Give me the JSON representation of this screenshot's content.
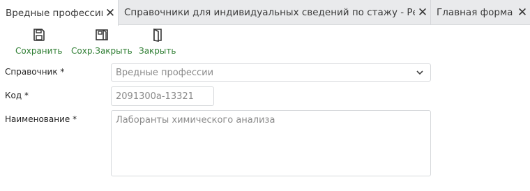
{
  "tabs": [
    {
      "label": "Вредные профессии",
      "active": true
    },
    {
      "label": "Справочники для индивидуальных сведений по стажу - Реестр",
      "active": false
    },
    {
      "label": "Главная форма",
      "active": false
    }
  ],
  "toolbar": {
    "save_label": "Сохранить",
    "save_close_label": "Сохр.Закрыть",
    "close_label": "Закрыть"
  },
  "form": {
    "reference": {
      "label": "Справочник *",
      "value": "Вредные профессии"
    },
    "code": {
      "label": "Код *",
      "value": "2091300а-13321"
    },
    "name": {
      "label": "Наименование *",
      "value": "Лаборанты химического анализа"
    }
  },
  "colors": {
    "accent": "#2e7d32",
    "tabbar": "#e9eaec"
  }
}
